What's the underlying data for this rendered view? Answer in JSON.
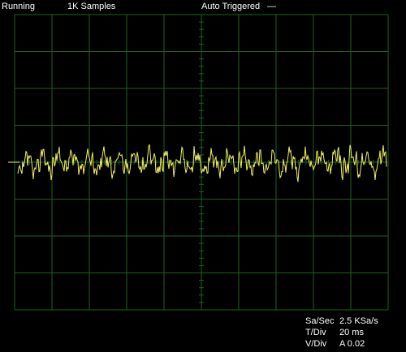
{
  "status": {
    "run_state": "Running",
    "samples": "1K Samples",
    "trigger_mode": "Auto Triggered",
    "trigger_indicator": "—"
  },
  "readouts": {
    "sample_rate_label": "Sa/Sec",
    "sample_rate_value": "2.5 KSa/s",
    "time_div_label": "T/Div",
    "time_div_value": "20 ms",
    "volt_div_label": "V/Div",
    "volt_div_value": "A 0.02"
  },
  "colors": {
    "background": "#000000",
    "grid": "#1f5f1f",
    "trace": "#f0f060",
    "text": "#ffffff"
  },
  "scope": {
    "h_divisions": 10,
    "v_divisions": 8,
    "subdiv_per_div": 5
  }
}
